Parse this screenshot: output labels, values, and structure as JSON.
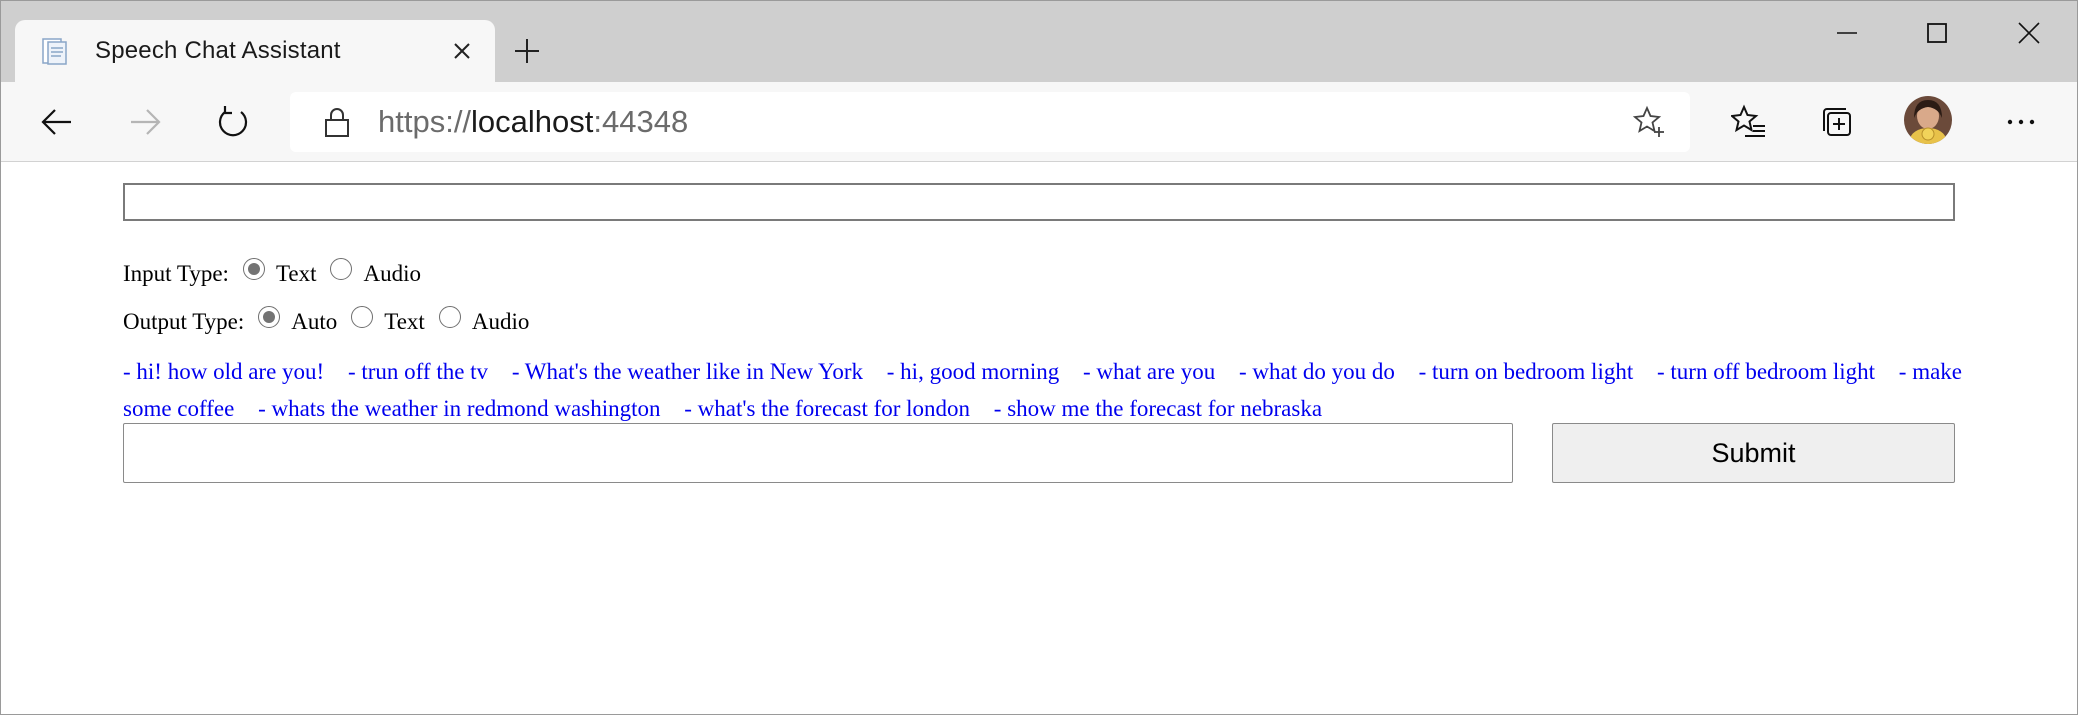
{
  "browser": {
    "tab": {
      "title": "Speech Chat Assistant"
    },
    "address": {
      "scheme": "https://",
      "host": "localhost",
      "port": ":44348"
    },
    "icons": {
      "back": "back-arrow-icon",
      "forward": "forward-arrow-icon",
      "refresh": "refresh-icon",
      "lock": "lock-icon",
      "add_favorite": "star-plus-icon",
      "favorites": "favorites-icon",
      "collections": "collections-icon",
      "more": "more-icon"
    }
  },
  "form": {
    "input_type": {
      "label": "Input Type:",
      "options": [
        "Text",
        "Audio"
      ],
      "selected": "Text"
    },
    "output_type": {
      "label": "Output Type:",
      "options": [
        "Auto",
        "Text",
        "Audio"
      ],
      "selected": "Auto"
    },
    "suggestions": [
      "- hi! how old are you!",
      "- trun off the tv",
      "- What's the weather like in New York",
      "- hi, good morning",
      "- what are you",
      "- what do you do",
      "- turn on bedroom light",
      "- turn off bedroom light",
      "- make some coffee",
      "- whats the weather in redmond washington",
      "- what's the forecast for london",
      "- show me the forecast for nebraska"
    ],
    "message_value": "",
    "submit_label": "Submit"
  },
  "colors": {
    "link": "#0000ee",
    "tab_strip": "#cfcfcf",
    "toolbar": "#f7f7f7"
  }
}
